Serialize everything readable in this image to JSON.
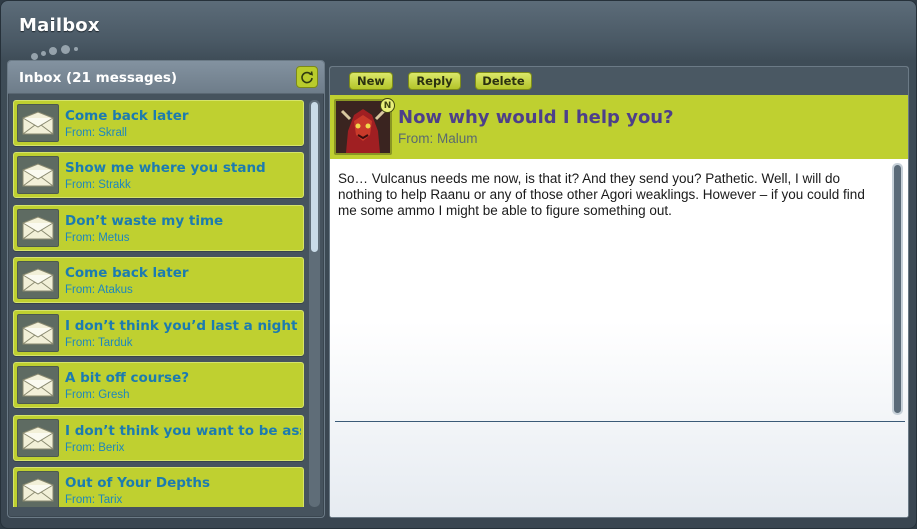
{
  "window": {
    "title": "Mailbox"
  },
  "inbox": {
    "title": "Inbox (21 messages)",
    "messages": [
      {
        "subject": "Come back later",
        "from": "From: Skrall"
      },
      {
        "subject": "Show me where you stand",
        "from": "From: Strakk"
      },
      {
        "subject": "Don’t waste my time",
        "from": "From: Metus"
      },
      {
        "subject": "Come back later",
        "from": "From: Atakus"
      },
      {
        "subject": "I don’t think you’d last a night in th",
        "from": "From: Tarduk"
      },
      {
        "subject": "A bit off course?",
        "from": "From: Gresh"
      },
      {
        "subject": "I don’t think you want to be associ",
        "from": "From: Berix"
      },
      {
        "subject": "Out of Your Depths",
        "from": "From: Tarix"
      }
    ]
  },
  "toolbar": {
    "new_label": "New",
    "reply_label": "Reply",
    "delete_label": "Delete"
  },
  "reader": {
    "badge": "N",
    "subject": "Now why would I help you?",
    "from": "From: Malum",
    "body": "So… Vulcanus needs me now, is that it? And they send you? Pathetic. Well, I will do nothing to help Raanu or any of those other Agori weaklings. However – if you could find me some ammo I might be able to figure something out."
  },
  "icons": {
    "refresh": "refresh-icon",
    "message": "envelope-icon",
    "sender": "avatar-image"
  },
  "colors": {
    "accent": "#bfd030",
    "subject_link": "#1c7bb0",
    "reader_subject": "#4d3f8a"
  }
}
